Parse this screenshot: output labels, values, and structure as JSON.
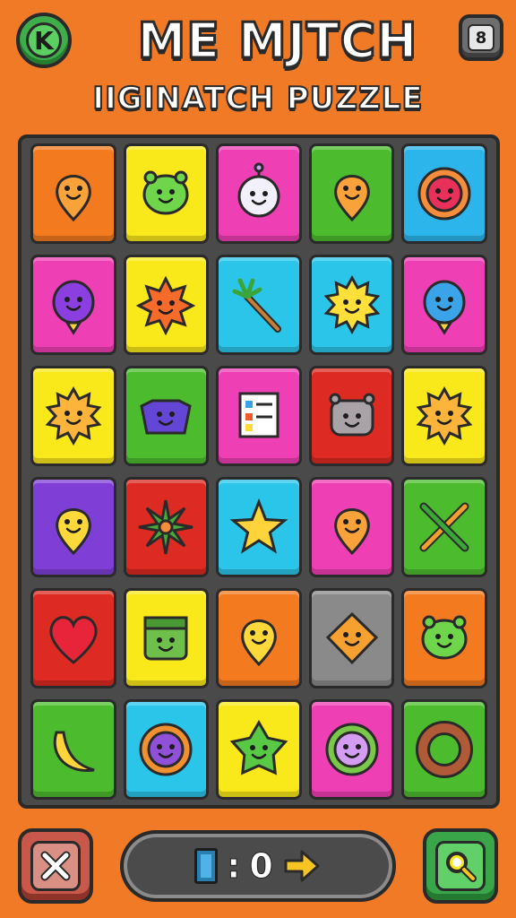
{
  "header": {
    "title": "ME MJTCH",
    "subtitle": "IIGINATCH PUZZLE",
    "back_button_label": "K",
    "menu_button_label": "8"
  },
  "board": {
    "columns": 5,
    "rows": 6,
    "tiles": [
      {
        "color": "#f47a1f",
        "icon": "orange-drop-face-icon"
      },
      {
        "color": "#f9e81a",
        "icon": "green-blob-face-icon"
      },
      {
        "color": "#ef3fb5",
        "icon": "white-antenna-creature-icon"
      },
      {
        "color": "#4cbc2e",
        "icon": "orange-drop-face-icon"
      },
      {
        "color": "#2bb5ea",
        "icon": "red-flower-face-icon"
      },
      {
        "color": "#ef3fb5",
        "icon": "purple-balloon-creature-icon"
      },
      {
        "color": "#f9e81a",
        "icon": "orange-spiky-face-icon"
      },
      {
        "color": "#2bc5ea",
        "icon": "palm-stick-icon"
      },
      {
        "color": "#2bc5ea",
        "icon": "yellow-sun-face-icon"
      },
      {
        "color": "#ef3fb5",
        "icon": "blue-balloon-creature-icon"
      },
      {
        "color": "#f9e81a",
        "icon": "orange-sun-face-icon"
      },
      {
        "color": "#4cbc2e",
        "icon": "purple-monster-face-icon"
      },
      {
        "color": "#ef3fb5",
        "icon": "checklist-card-icon"
      },
      {
        "color": "#dd2a22",
        "icon": "gray-robot-face-icon"
      },
      {
        "color": "#f9e81a",
        "icon": "orange-sun-face-icon"
      },
      {
        "color": "#7f3fd6",
        "icon": "yellow-drop-face-icon"
      },
      {
        "color": "#dd2a22",
        "icon": "green-leaf-star-icon"
      },
      {
        "color": "#2bc5ea",
        "icon": "yellow-star-icon"
      },
      {
        "color": "#ef3fb5",
        "icon": "orange-drop-face-icon"
      },
      {
        "color": "#4cbc2e",
        "icon": "crossed-arrows-icon"
      },
      {
        "color": "#dd2a22",
        "icon": "red-heart-icon"
      },
      {
        "color": "#f9e81a",
        "icon": "green-square-creature-icon"
      },
      {
        "color": "#f47a1f",
        "icon": "yellow-drop-face-icon"
      },
      {
        "color": "#8a8a8a",
        "icon": "orange-diamond-face-icon"
      },
      {
        "color": "#f47a1f",
        "icon": "green-blob-face-icon"
      },
      {
        "color": "#4cbc2e",
        "icon": "banana-icon"
      },
      {
        "color": "#2bc5ea",
        "icon": "purple-flower-face-icon"
      },
      {
        "color": "#f9e81a",
        "icon": "green-star-face-icon"
      },
      {
        "color": "#ef3fb5",
        "icon": "lilac-flower-face-icon"
      },
      {
        "color": "#4cbc2e",
        "icon": "brown-ring-icon"
      }
    ]
  },
  "footer": {
    "close_button_icon": "close-icon",
    "score_separator": ":",
    "score_value": "0",
    "search_button_icon": "search-icon"
  }
}
